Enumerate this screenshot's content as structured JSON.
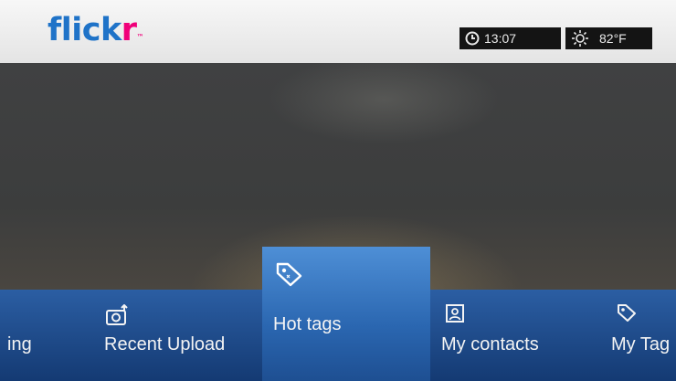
{
  "header": {
    "logo": {
      "part1": "flick",
      "part2": "r",
      "tm": "™"
    },
    "time": "13:07",
    "temperature": "82°F"
  },
  "menu": {
    "items": [
      {
        "label": "ing",
        "icon": "none"
      },
      {
        "label": "Recent Upload",
        "icon": "camera-upload-icon"
      },
      {
        "label": "Hot tags",
        "icon": "tag-icon",
        "selected": true
      },
      {
        "label": "My contacts",
        "icon": "contact-icon"
      },
      {
        "label": "My Tag",
        "icon": "tag-icon"
      }
    ]
  },
  "colors": {
    "flickr_blue": "#1f73c8",
    "flickr_pink": "#f0007a",
    "menu_band": "#1e4e8f",
    "selected_tile": "#3f7ecb"
  }
}
